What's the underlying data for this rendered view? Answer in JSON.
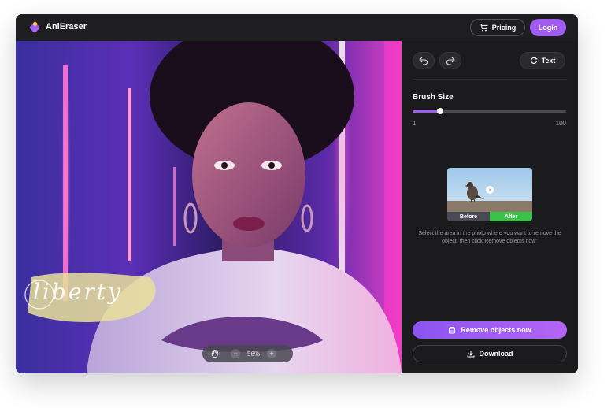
{
  "header": {
    "app_name": "AniEraser",
    "pricing_label": "Pricing",
    "login_label": "Login"
  },
  "canvas": {
    "watermark_text": "liberty",
    "zoom_level": "56%",
    "zoom_out_symbol": "−",
    "zoom_in_symbol": "+"
  },
  "panel": {
    "undo_icon": "undo-icon",
    "redo_icon": "redo-icon",
    "text_label": "Text",
    "brush_size_label": "Brush Size",
    "brush_min": "1",
    "brush_max": "100",
    "brush_value_fraction": 0.18,
    "before_label": "Before",
    "after_label": "After",
    "instruction": "Select the area in the photo where you want to remove the object, then click\"Remove objects now\"",
    "remove_label": "Remove objects now",
    "download_label": "Download"
  },
  "colors": {
    "accent": "#a05cf0",
    "panel_bg": "#1b1b1e",
    "after_green": "#3cc24a"
  }
}
